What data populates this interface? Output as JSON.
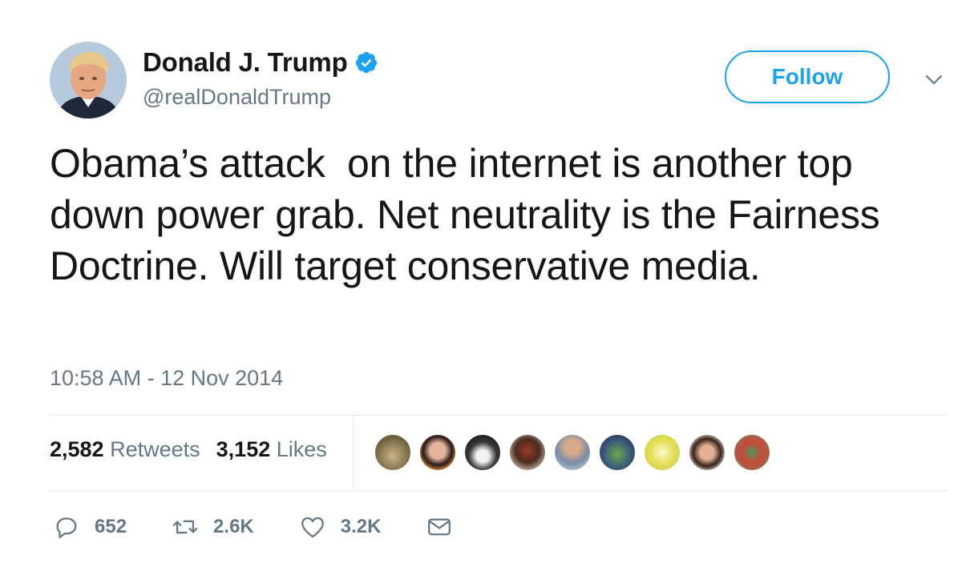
{
  "author": {
    "display_name": "Donald J. Trump",
    "handle": "@realDonaldTrump",
    "verified": true
  },
  "follow_button": {
    "label": "Follow"
  },
  "tweet": {
    "text": "Obama’s attack  on the internet is another top down power grab. Net neutrality is the Fairness Doctrine. Will target conservative media.",
    "timestamp": "10:58 AM - 12 Nov 2014"
  },
  "stats": {
    "retweets_count": "2,582",
    "retweets_label": "Retweets",
    "likes_count": "3,152",
    "likes_label": "Likes"
  },
  "actions": {
    "reply_count": "652",
    "retweet_count": "2.6K",
    "like_count": "3.2K"
  },
  "colors": {
    "accent": "#1da1f2",
    "text": "#14171a",
    "secondary": "#657786",
    "divider": "#e1e8ed"
  },
  "icons": [
    "verified-badge-icon",
    "chevron-down-icon",
    "reply-icon",
    "retweet-icon",
    "heart-icon",
    "envelope-icon"
  ]
}
